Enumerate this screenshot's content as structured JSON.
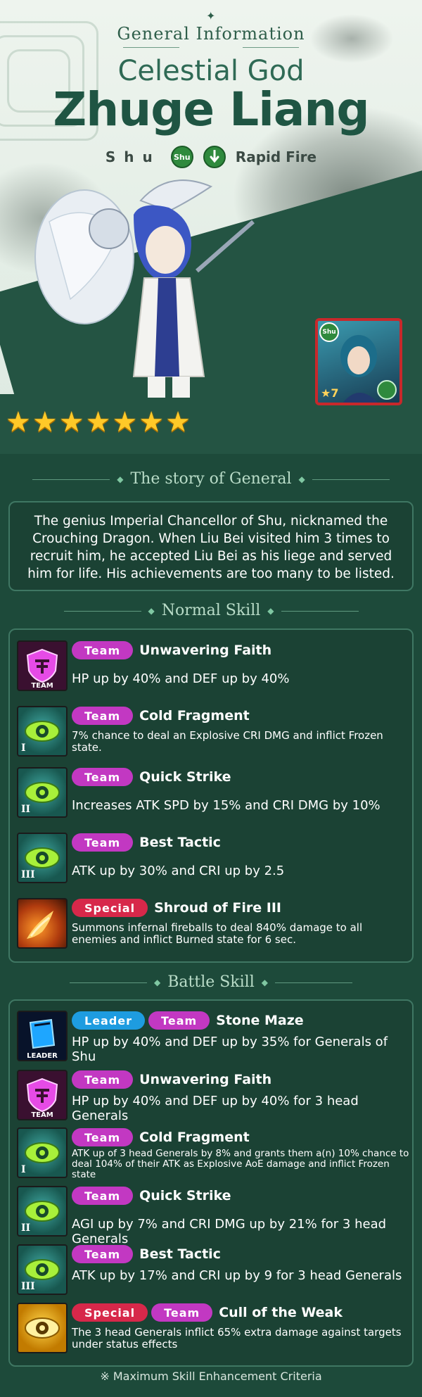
{
  "header": {
    "section_label": "General Information",
    "title_line1": "Celestial God",
    "title_line2": "Zhuge Liang",
    "faction": "Shu",
    "faction_badge": "Shu",
    "type": "Rapid Fire"
  },
  "portrait": {
    "faction_badge": "Shu",
    "level": "★7"
  },
  "rarity": {
    "stars": 7,
    "star_glyph": "★"
  },
  "colors": {
    "accent_green": "#1f5543",
    "tag_team": "#c238c2",
    "tag_special": "#d7284a",
    "tag_leader": "#1e9ce0",
    "star": "#ffc928"
  },
  "story": {
    "title": "The story of General",
    "text": "The genius Imperial Chancellor of Shu, nicknamed the Crouching Dragon. When Liu Bei visited him 3 times to recruit him, he accepted Liu Bei as his liege and served him for life. His achievements are too many to be listed."
  },
  "normal_skill": {
    "title": "Normal Skill",
    "skills": [
      {
        "icon": "team-shield-icon",
        "icon_label": "TEAM",
        "tags": [
          "Team"
        ],
        "name": "Unwavering Faith",
        "desc": "HP up by 40% and DEF up by 40%"
      },
      {
        "icon": "green-eye-icon",
        "icon_label": "I",
        "tags": [
          "Team"
        ],
        "name": "Cold Fragment",
        "desc": "7% chance to deal an Explosive CRI DMG  and inflict Frozen state."
      },
      {
        "icon": "green-eye-icon",
        "icon_label": "II",
        "tags": [
          "Team"
        ],
        "name": "Quick Strike",
        "desc": "Increases ATK SPD by 15% and CRI DMG by 10%"
      },
      {
        "icon": "green-eye-icon",
        "icon_label": "III",
        "tags": [
          "Team"
        ],
        "name": "Best Tactic",
        "desc": "ATK up by 30% and CRI up by 2.5"
      },
      {
        "icon": "fireball-icon",
        "icon_label": "",
        "tags": [
          "Special"
        ],
        "name": "Shroud of Fire III",
        "desc": "Summons infernal fireballs to deal 840% damage to all enemies and inflict Burned state for 6 sec."
      }
    ]
  },
  "battle_skill": {
    "title": "Battle Skill",
    "skills": [
      {
        "icon": "leader-book-icon",
        "icon_label": "LEADER",
        "tags": [
          "Leader",
          "Team"
        ],
        "name": "Stone Maze",
        "desc": "HP up by 40% and DEF up by 35% for Generals of Shu"
      },
      {
        "icon": "team-shield-icon",
        "icon_label": "TEAM",
        "tags": [
          "Team"
        ],
        "name": "Unwavering Faith",
        "desc": "HP up by 40% and DEF up by 40% for 3 head Generals"
      },
      {
        "icon": "green-eye-icon",
        "icon_label": "I",
        "tags": [
          "Team"
        ],
        "name": "Cold Fragment",
        "desc": "ATK up of 3 head Generals by 8% and grants them a(n) 10% chance to deal 104% of their ATK as Explosive AoE damage and inflict Frozen state"
      },
      {
        "icon": "green-eye-icon",
        "icon_label": "II",
        "tags": [
          "Team"
        ],
        "name": "Quick Strike",
        "desc": "AGI up by 7% and CRI DMG up by 21% for 3 head Generals"
      },
      {
        "icon": "green-eye-icon",
        "icon_label": "III",
        "tags": [
          "Team"
        ],
        "name": "Best Tactic",
        "desc": "ATK up by 17% and CRI up by 9 for 3 head Generals"
      },
      {
        "icon": "gold-eye-icon",
        "icon_label": "",
        "tags": [
          "Special",
          "Team"
        ],
        "name": "Cull of the Weak",
        "desc": "The 3 head Generals inflict 65% extra damage against targets under status effects"
      }
    ]
  },
  "footer": {
    "note": "※ Maximum Skill Enhancement Criteria"
  }
}
